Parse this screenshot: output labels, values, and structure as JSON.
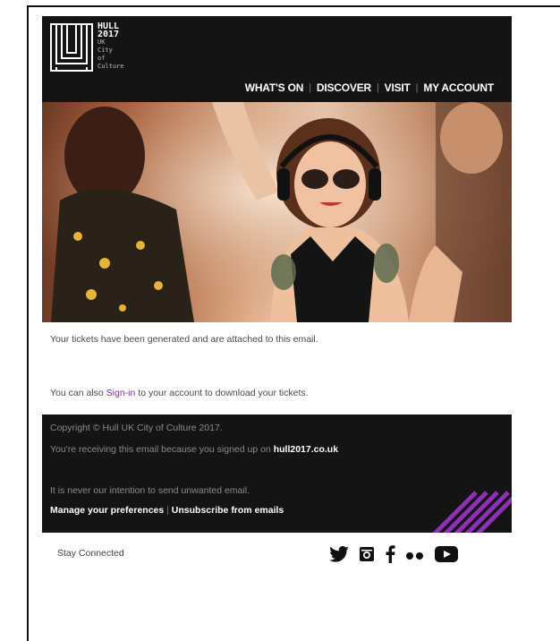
{
  "brand": {
    "line1": "HULL",
    "line2": "2017",
    "line3": "UK",
    "line4": "City",
    "line5": "of",
    "line6": "Culture"
  },
  "nav": {
    "items": [
      "WHAT'S ON",
      "DISCOVER",
      "VISIT",
      "MY ACCOUNT"
    ],
    "separator": "|"
  },
  "body": {
    "message1": "Your tickets have been generated and are attached to this email.",
    "message2_before": "You can also ",
    "message2_link": "Sign-in",
    "message2_after": " to your account to download your tickets."
  },
  "footer": {
    "copyright": "Copyright © Hull UK City of Culture 2017.",
    "reason_text": "You're receiving this email because you signed up on ",
    "reason_link": "hull2017.co.uk",
    "intent": "It is never our intention to send unwanted email.",
    "manage_link": "Manage your preferences",
    "link_separator": "|",
    "unsubscribe_link": "Unsubscribe from emails"
  },
  "social": {
    "label": "Stay Connected",
    "icons": [
      "twitter-icon",
      "instagram-icon",
      "facebook-icon",
      "flickr-icon",
      "youtube-icon"
    ]
  },
  "colors": {
    "header_bg": "#141414",
    "link": "#7b2fa1",
    "accent_stripes": "#8e2fb5"
  }
}
